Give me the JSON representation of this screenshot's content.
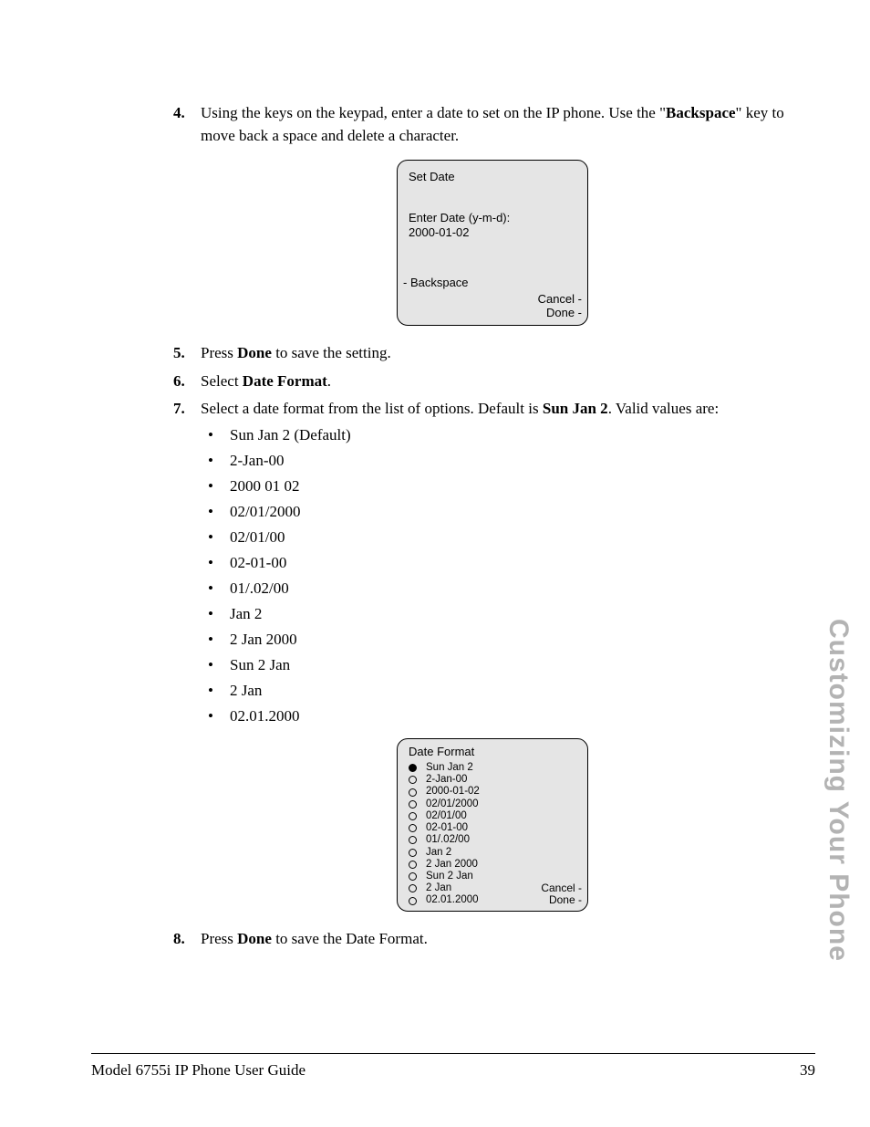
{
  "steps": {
    "s4": {
      "num": "4.",
      "text_a": "Using the keys on the keypad, enter a date to set on the IP phone. Use the \"",
      "text_b": "Backspace",
      "text_c": "\" key to move back a space and delete a character."
    },
    "s5": {
      "num": "5.",
      "text_a": "Press ",
      "text_b": "Done",
      "text_c": " to save the setting."
    },
    "s6": {
      "num": "6.",
      "text_a": "Select ",
      "text_b": "Date Format",
      "text_c": "."
    },
    "s7": {
      "num": "7.",
      "text_a": "Select a date format from the list of options. Default is ",
      "text_b": "Sun Jan 2",
      "text_c": ". Valid values are:"
    },
    "s8": {
      "num": "8.",
      "text_a": "Press ",
      "text_b": "Done",
      "text_c": " to save the Date Format."
    }
  },
  "bullets": [
    "Sun Jan 2 (Default)",
    "2-Jan-00",
    "2000 01 02",
    "02/01/2000",
    "02/01/00",
    "02-01-00",
    "01/.02/00",
    "Jan 2",
    "2 Jan 2000",
    "Sun 2 Jan",
    "2 Jan",
    "02.01.2000"
  ],
  "screen1": {
    "title": "Set Date",
    "prompt": "Enter Date (y-m-d):",
    "value": "2000-01-02",
    "backspace": "- Backspace",
    "cancel": "Cancel -",
    "done": "Done -"
  },
  "screen2": {
    "title": "Date Format",
    "options": [
      "Sun Jan 2",
      "2-Jan-00",
      "2000-01-02",
      "02/01/2000",
      "02/01/00",
      "02-01-00",
      "01/.02/00",
      "Jan 2",
      "2 Jan 2000",
      "Sun 2 Jan",
      "2 Jan",
      "02.01.2000"
    ],
    "cancel": "Cancel -",
    "done": "Done -"
  },
  "side_tab": "Customizing Your Phone",
  "footer": {
    "left": "Model 6755i IP Phone User Guide",
    "right": "39"
  }
}
